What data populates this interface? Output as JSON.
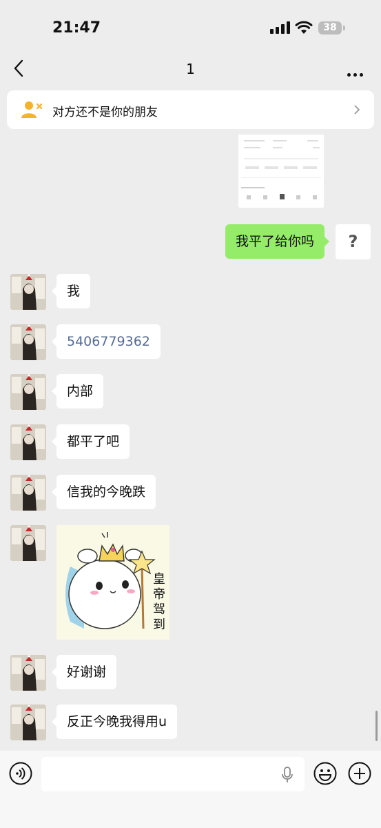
{
  "status_bar": {
    "time": "21:47",
    "battery": "38"
  },
  "header": {
    "title": "1"
  },
  "notice": {
    "text": "对方还不是你的朋友"
  },
  "messages": {
    "sent_1": "我平了给你吗",
    "sent_avatar_mark": "?",
    "recv_1": "我",
    "recv_2": "5406779362",
    "recv_3": "内部",
    "recv_4": "都平了吧",
    "recv_5": "信我的今晚跌",
    "sticker_caption": "皇帝驾到",
    "recv_6": "好谢谢",
    "recv_7": "反正今晚我得用u"
  },
  "colors": {
    "sent_bubble": "#95ec69",
    "link_number": "#576b95",
    "background": "#ededed"
  }
}
